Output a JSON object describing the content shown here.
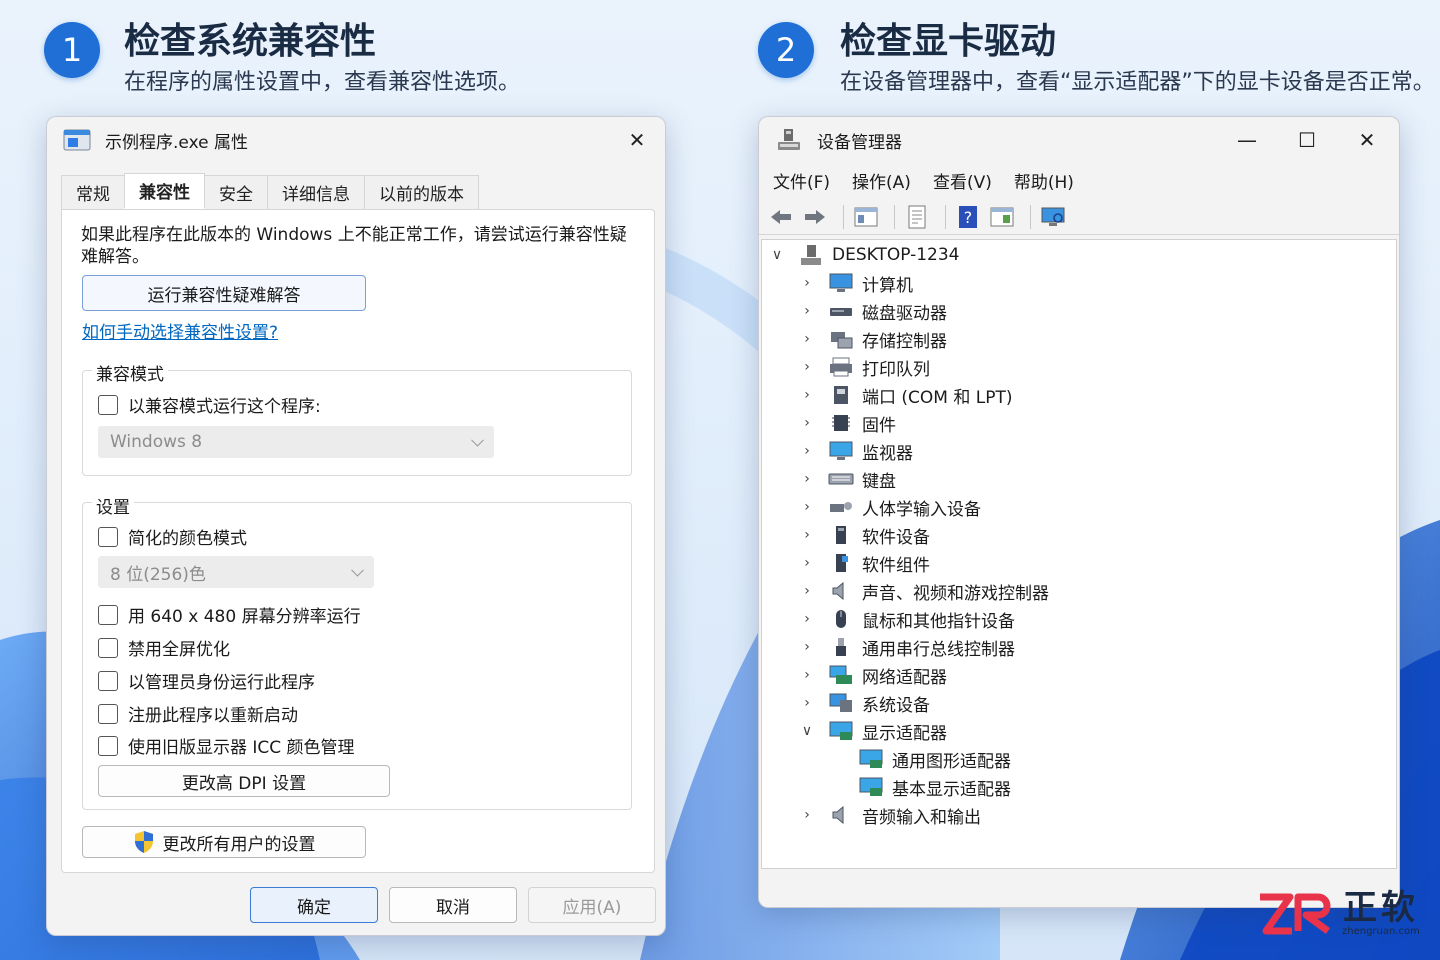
{
  "step1": {
    "number": "1",
    "title": "检查系统兼容性",
    "desc": "在程序的属性设置中，查看兼容性选项。"
  },
  "step2": {
    "number": "2",
    "title": "检查显卡驱动",
    "desc": "在设备管理器中，查看“显示适配器”下的显卡设备是否正常。"
  },
  "props": {
    "title": "示例程序.exe 属性",
    "close": "✕",
    "tabs": [
      "常规",
      "兼容性",
      "安全",
      "详细信息",
      "以前的版本"
    ],
    "active_tab": "兼容性",
    "intro": "如果此程序在此版本的 Windows 上不能正常工作，请尝试运行兼容性疑难解答。",
    "troubleshoot_button": "运行兼容性疑难解答",
    "manual_link": "如何手动选择兼容性设置?",
    "compat_mode_group": "兼容模式",
    "compat_mode_checkbox": "以兼容模式运行这个程序:",
    "compat_mode_select": "Windows 8",
    "settings_group": "设置",
    "reduced_color_checkbox": "简化的颜色模式",
    "color_select": "8 位(256)色",
    "checkboxes": [
      "用 640 x 480 屏幕分辨率运行",
      "禁用全屏优化",
      "以管理员身份运行此程序",
      "注册此程序以重新启动",
      "使用旧版显示器 ICC 颜色管理"
    ],
    "dpi_button": "更改高 DPI 设置",
    "all_users_button": "更改所有用户的设置",
    "ok": "确定",
    "cancel": "取消",
    "apply": "应用(A)"
  },
  "devmgr": {
    "title": "设备管理器",
    "window_buttons": {
      "minimize": "—",
      "maximize": "☐",
      "close": "✕"
    },
    "menus": [
      "文件(F)",
      "操作(A)",
      "查看(V)",
      "帮助(H)"
    ],
    "root": "DESKTOP-1234",
    "categories": [
      "计算机",
      "磁盘驱动器",
      "存储控制器",
      "打印队列",
      "端口 (COM 和 LPT)",
      "固件",
      "监视器",
      "键盘",
      "人体学输入设备",
      "软件设备",
      "软件组件",
      "声音、视频和游戏控制器",
      "鼠标和其他指针设备",
      "通用串行总线控制器",
      "网络适配器",
      "系统设备",
      "显示适配器"
    ],
    "display_children": [
      "通用图形适配器",
      "基本显示适配器"
    ],
    "last_category": "音频输入和输出",
    "icons": [
      "computer-icon",
      "disk-drive-icon",
      "storage-controller-icon",
      "print-queue-icon",
      "port-icon",
      "firmware-icon",
      "monitor-icon",
      "keyboard-icon",
      "hid-icon",
      "software-device-icon",
      "software-component-icon",
      "sound-icon",
      "mouse-icon",
      "usb-icon",
      "network-adapter-icon",
      "system-device-icon",
      "display-adapter-icon"
    ]
  },
  "brand": {
    "name": "正软",
    "url": "zhengruan.com"
  },
  "colors": {
    "accent": "#1f6fd6",
    "link": "#0067c0",
    "brand_red": "#e8334a"
  }
}
